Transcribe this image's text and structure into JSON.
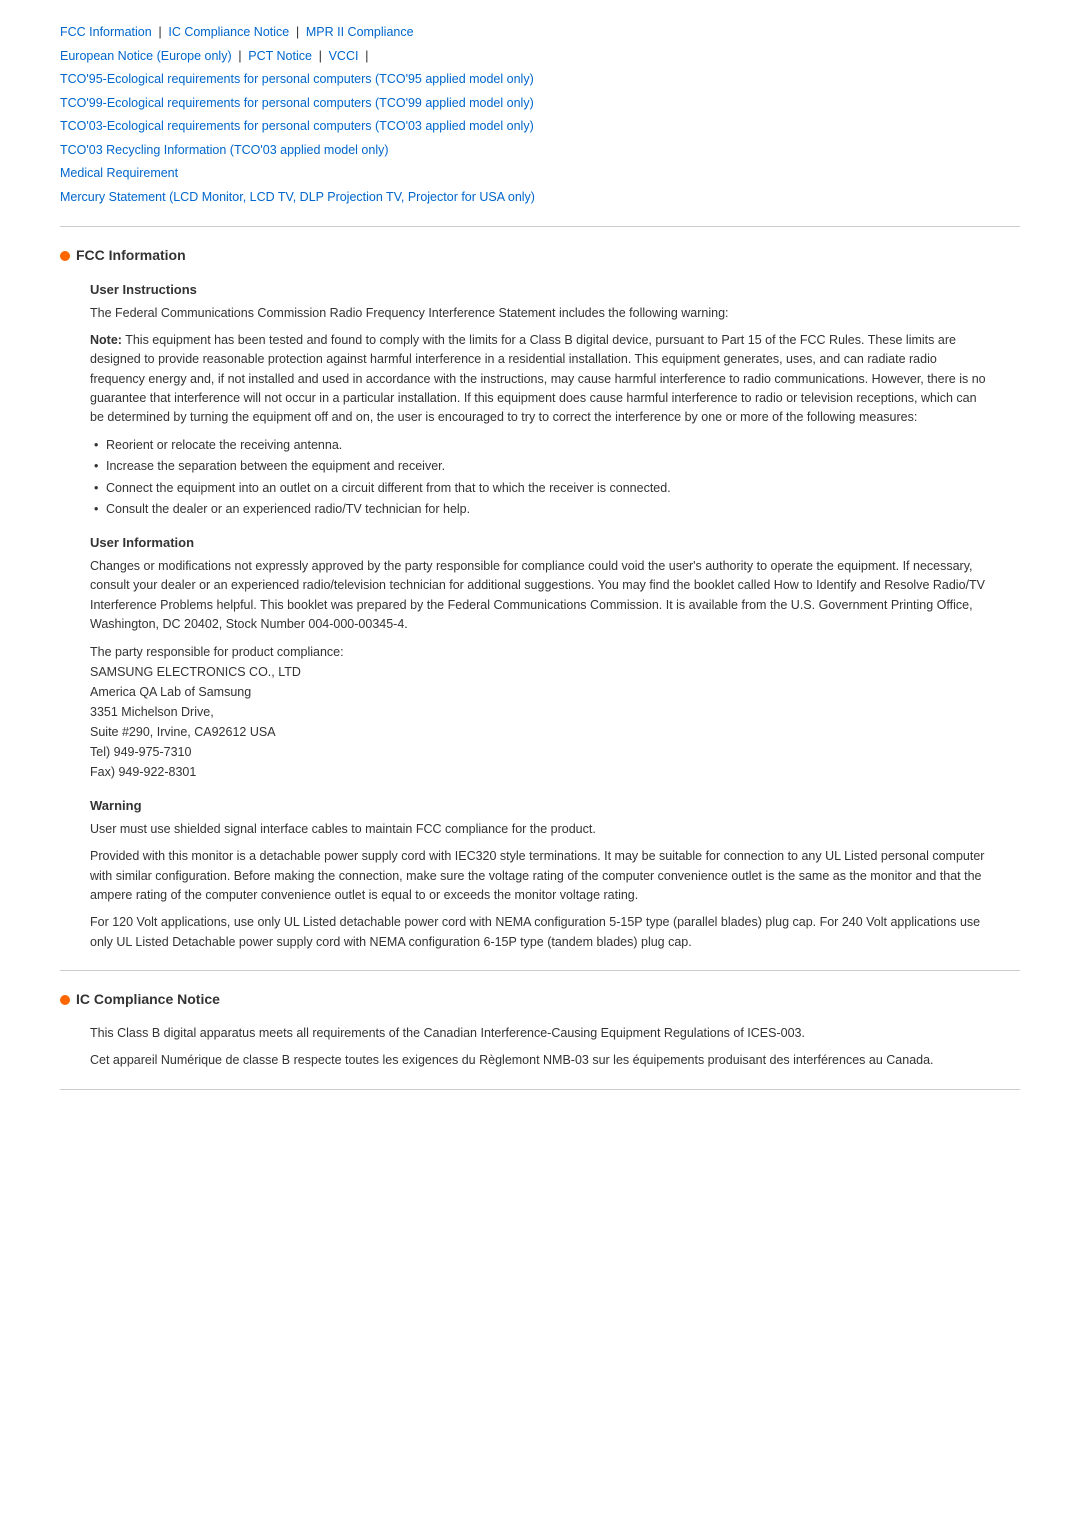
{
  "nav": {
    "links": [
      {
        "label": "FCC Information",
        "id": "fcc"
      },
      {
        "label": "IC Compliance Notice",
        "id": "ic"
      },
      {
        "label": "MPR II Compliance",
        "id": "mpr"
      },
      {
        "label": "European Notice (Europe only)",
        "id": "eu"
      },
      {
        "label": "PCT Notice",
        "id": "pct"
      },
      {
        "label": "VCCI",
        "id": "vcci"
      },
      {
        "label": "TCO'95-Ecological requirements for personal computers (TCO'95 applied model only)",
        "id": "tco95"
      },
      {
        "label": "TCO'99-Ecological requirements for personal computers (TCO'99 applied model only)",
        "id": "tco99"
      },
      {
        "label": "TCO'03-Ecological requirements for personal computers (TCO'03 applied model only)",
        "id": "tco03"
      },
      {
        "label": "TCO'03 Recycling Information (TCO'03 applied model only)",
        "id": "tco03r"
      },
      {
        "label": "Medical Requirement",
        "id": "med"
      },
      {
        "label": "Mercury Statement (LCD Monitor, LCD TV, DLP Projection TV, Projector for USA only)",
        "id": "mercury"
      }
    ]
  },
  "fcc_section": {
    "title": "FCC Information",
    "user_instructions": {
      "subtitle": "User Instructions",
      "intro": "The Federal Communications Commission Radio Frequency Interference Statement includes the following warning:",
      "note_label": "Note:",
      "note_text": " This equipment has been tested and found to comply with the limits for a Class B digital device, pursuant to Part 15 of the FCC Rules. These limits are designed to provide reasonable protection against harmful interference in a residential installation. This equipment generates, uses, and can radiate radio frequency energy and, if not installed and used in accordance with the instructions, may cause harmful interference to radio communications. However, there is no guarantee that interference will not occur in a particular installation. If this equipment does cause harmful interference to radio or television receptions, which can be determined by turning the equipment off and on, the user is encouraged to try to correct the interference by one or more of the following measures:",
      "bullets": [
        "Reorient or relocate the receiving antenna.",
        "Increase the separation between the equipment and receiver.",
        "Connect the equipment into an outlet on a circuit different from that to which the receiver is connected.",
        "Consult the dealer or an experienced radio/TV technician for help."
      ]
    },
    "user_information": {
      "subtitle": "User Information",
      "para1": "Changes or modifications not expressly approved by the party responsible for compliance could void the user's authority to operate the equipment. If necessary, consult your dealer or an experienced radio/television technician for additional suggestions. You may find the booklet called How to Identify and Resolve Radio/TV Interference Problems helpful. This booklet was prepared by the Federal Communications Commission. It is available from the U.S. Government Printing Office, Washington, DC 20402, Stock Number 004-000-00345-4.",
      "para2_label": "The party responsible for product compliance:",
      "address": [
        "SAMSUNG ELECTRONICS CO., LTD",
        "America QA Lab of Samsung",
        "3351 Michelson Drive,",
        "Suite #290, Irvine, CA92612 USA",
        "Tel) 949-975-7310",
        "Fax) 949-922-8301"
      ]
    },
    "warning": {
      "subtitle": "Warning",
      "para1": "User must use shielded signal interface cables to maintain FCC compliance for the product.",
      "para2": "Provided with this monitor is a detachable power supply cord with IEC320 style terminations. It may be suitable for connection to any UL Listed personal computer with similar configuration. Before making the connection, make sure the voltage rating of the computer convenience outlet is the same as the monitor and that the ampere rating of the computer convenience outlet is equal to or exceeds the monitor voltage rating.",
      "para3": "For 120 Volt applications, use only UL Listed detachable power cord with NEMA configuration 5-15P type (parallel blades) plug cap. For 240 Volt applications use only UL Listed Detachable power supply cord with NEMA configuration 6-15P type (tandem blades) plug cap."
    }
  },
  "ic_section": {
    "title": "IC Compliance Notice",
    "para1": "This Class B digital apparatus meets all requirements of the Canadian Interference-Causing Equipment Regulations of ICES-003.",
    "para2": "Cet appareil Numérique de classe B respecte toutes les exigences du Règlemont NMB-03 sur les équipements produisant des interférences au Canada."
  }
}
